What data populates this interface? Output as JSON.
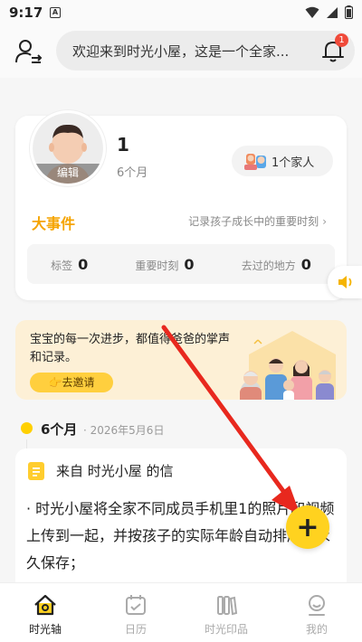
{
  "status_bar": {
    "time": "9:17",
    "a_icon": "A"
  },
  "header": {
    "search_text": "欢迎来到时光小屋，这是一个全家...",
    "notification_count": "1"
  },
  "profile": {
    "avatar_edit_label": "编辑",
    "child_name": "1",
    "child_age": "6个月",
    "family_label": "1个家人"
  },
  "events": {
    "title": "大事件",
    "hint": "记录孩子成长中的重要时刻",
    "stats": [
      {
        "label": "标签",
        "value": "0"
      },
      {
        "label": "重要时刻",
        "value": "0"
      },
      {
        "label": "去过的地方",
        "value": "0"
      }
    ]
  },
  "banner": {
    "text": "宝宝的每一次进步，都值得爸爸的掌声和记录。",
    "invite_label": "👉去邀请"
  },
  "timeline": {
    "age": "6个月",
    "date": "· 2026年5月6日",
    "letter_from": "来自 时光小屋 的信",
    "letter_body": "· 时光小屋将全家不同成员手机里1的照片和视频上传到一起，并按孩子的实际年龄自动排序，永久保存；"
  },
  "fab": {
    "label": "+"
  },
  "bottom_nav": [
    {
      "label": "时光轴",
      "icon": "home-icon",
      "active": true
    },
    {
      "label": "日历",
      "icon": "calendar-icon",
      "active": false
    },
    {
      "label": "时光印品",
      "icon": "books-icon",
      "active": false
    },
    {
      "label": "我的",
      "icon": "user-icon",
      "active": false
    }
  ],
  "colors": {
    "accent": "#ffd21f",
    "event_title": "#f5a400",
    "badge": "#f04a3a",
    "banner_bg": "#fdf0d6",
    "arrow": "#e8281e"
  }
}
